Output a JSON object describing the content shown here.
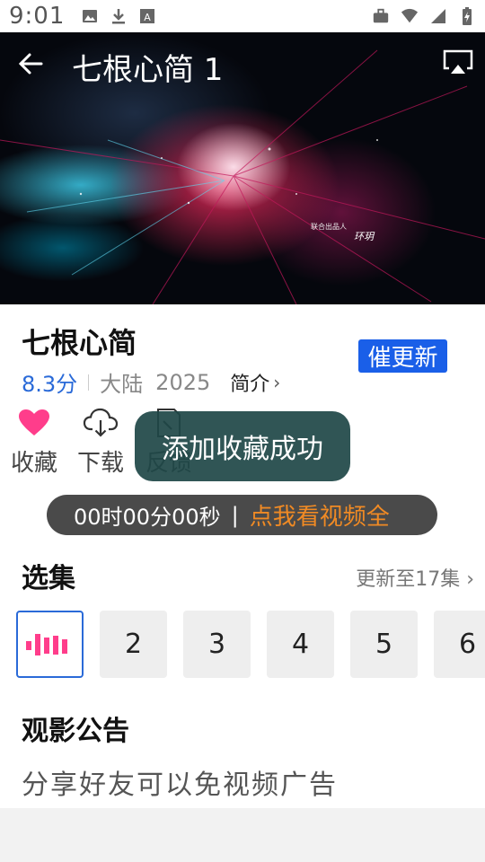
{
  "status_bar": {
    "time": "9:01",
    "left_icons": [
      "image-icon",
      "download-icon",
      "font-icon"
    ],
    "right_icons": [
      "briefcase-icon",
      "wifi-icon",
      "signal-icon",
      "battery-icon"
    ]
  },
  "player": {
    "title": "七根心简 1",
    "watermark_small": "联合出品人",
    "watermark_name": "环玥"
  },
  "show": {
    "title": "七根心简",
    "urge_label": "催更新",
    "score": "8.3分",
    "region": "大陆",
    "year": "2025",
    "intro_label": "简介",
    "intro_chevron": "›"
  },
  "actions": {
    "favorite_label": "收藏",
    "download_label": "下载",
    "feedback_label": "反馈"
  },
  "toast": {
    "message": "添加收藏成功"
  },
  "timer": {
    "countdown": "00时00分00秒",
    "separator": "|",
    "link_text": "点我看视频全"
  },
  "episodes_section": {
    "title": "选集",
    "update_info": "更新至17集 ›",
    "items": [
      "2",
      "3",
      "4",
      "5",
      "6"
    ]
  },
  "notice_section": {
    "title": "观影公告",
    "text": "分享好友可以免视频广告"
  },
  "colors": {
    "accent_blue": "#1a5fe8",
    "heart_pink": "#ff3d8b",
    "link_orange": "#f08a24",
    "toast_bg": "#1e4646"
  }
}
